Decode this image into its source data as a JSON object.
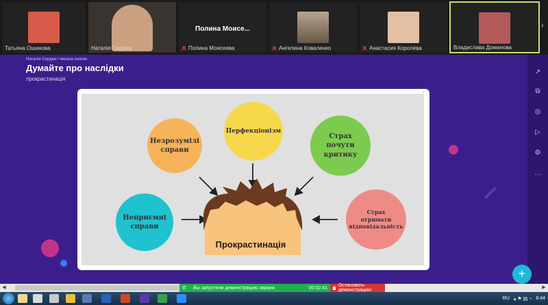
{
  "participants": [
    {
      "name": "Татьяна Ошинова",
      "muted": false,
      "photo_color": "#d95a4a"
    },
    {
      "name": "Наталія Сердюк",
      "muted": false,
      "photo_color": "#caa080"
    },
    {
      "name": "Полина Моисеева",
      "muted": true,
      "display": "Полина  Моисе..."
    },
    {
      "name": "Ангелина Коваленко",
      "muted": true,
      "photo_color": "#8a6a58"
    },
    {
      "name": "Анастасия Королёва",
      "muted": true,
      "photo_color": "#e3c0a4"
    },
    {
      "name": "Владислава Доманова",
      "muted": false,
      "photo_color": "#b45a5a",
      "active": true
    }
  ],
  "presentation": {
    "breadcrumb": "Наталія Сердюк • менше кнопки",
    "title": "Думайте про наслідки",
    "subtitle": "прокрастинація"
  },
  "slide": {
    "center": "Прокрастинація",
    "bubbles": [
      {
        "id": "left-top",
        "lines": [
          "Незрозумілі",
          "справи"
        ],
        "color": "#f7b35a"
      },
      {
        "id": "top",
        "lines": [
          "Перфекціонізм"
        ],
        "color": "#f7d84c"
      },
      {
        "id": "right-top",
        "lines": [
          "Страх",
          "почути",
          "критику"
        ],
        "color": "#7ccb4f"
      },
      {
        "id": "left-bottom",
        "lines": [
          "Неприємні",
          "справи"
        ],
        "color": "#1fc2cf"
      },
      {
        "id": "right-bottom",
        "lines": [
          "Страх",
          "отримати",
          "відповідальність"
        ],
        "color": "#ef8b86"
      }
    ],
    "head_hair_color": "#6b3a1f",
    "head_skin_color": "#f7c37d"
  },
  "share_bar": {
    "message": "Вы запустили демонстрацию экрана",
    "timer": "00:02:41",
    "stop_label": "Остановить демонстрацию"
  },
  "rail_icons": [
    "share-icon",
    "crop-icon",
    "pin-icon",
    "play-icon",
    "settings-icon",
    "more-icon"
  ],
  "fab_label": "+",
  "taskbar": {
    "lang": "RU",
    "time": "8:44"
  },
  "colors": {
    "stage": "#3a1f8c",
    "accent_green": "#20b24a",
    "accent_red": "#d93832",
    "fab": "#1db9d6"
  }
}
